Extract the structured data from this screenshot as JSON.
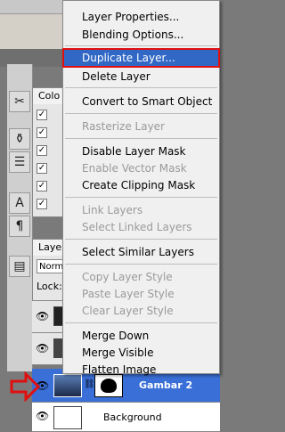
{
  "panels": {
    "channels_tab": "Colo",
    "layers_tab": "Laye",
    "blend_mode": "Norma",
    "lock_label": "Lock:"
  },
  "layers": [
    {
      "name": "Gambar 2",
      "selected": true
    },
    {
      "name": "Background",
      "selected": false
    }
  ],
  "context_menu": {
    "items": [
      {
        "label": "Layer Properties...",
        "enabled": true
      },
      {
        "label": "Blending Options...",
        "enabled": true
      },
      {
        "label": "Duplicate Layer...",
        "enabled": true,
        "highlighted": true
      },
      {
        "label": "Delete Layer",
        "enabled": true
      },
      {
        "label": "Convert to Smart Object",
        "enabled": true
      },
      {
        "label": "Rasterize Layer",
        "enabled": false
      },
      {
        "label": "Disable Layer Mask",
        "enabled": true
      },
      {
        "label": "Enable Vector Mask",
        "enabled": false
      },
      {
        "label": "Create Clipping Mask",
        "enabled": true
      },
      {
        "label": "Link Layers",
        "enabled": false
      },
      {
        "label": "Select Linked Layers",
        "enabled": false
      },
      {
        "label": "Select Similar Layers",
        "enabled": true
      },
      {
        "label": "Copy Layer Style",
        "enabled": false
      },
      {
        "label": "Paste Layer Style",
        "enabled": false
      },
      {
        "label": "Clear Layer Style",
        "enabled": false
      },
      {
        "label": "Merge Down",
        "enabled": true
      },
      {
        "label": "Merge Visible",
        "enabled": true
      },
      {
        "label": "Flatten Image",
        "enabled": true
      }
    ]
  },
  "colors": {
    "highlight": "#3168c6",
    "highlight_border": "#e01010",
    "arrow": "#e01010",
    "layer_selected_bg": "#3a6fd8"
  },
  "icons": [
    "brush-tools-icon",
    "clone-stamp-icon",
    "history-icon",
    "text-icon",
    "paragraph-icon",
    "navigator-icon",
    "eye-icon",
    "chain-link-icon",
    "pointer-arrow-icon"
  ]
}
